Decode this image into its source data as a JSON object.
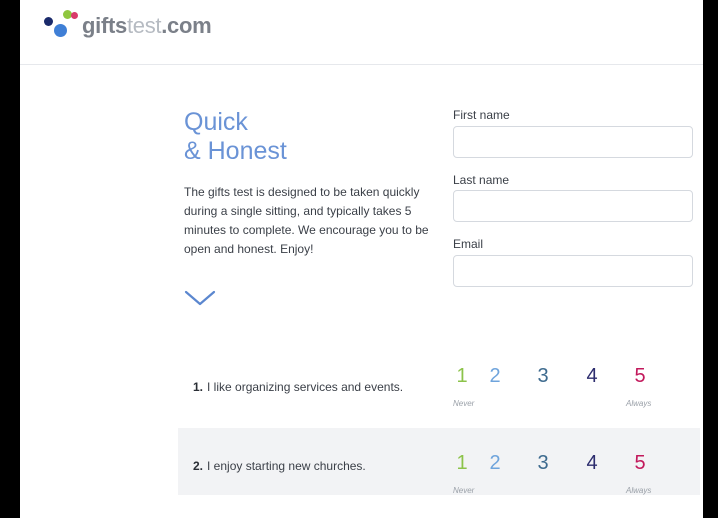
{
  "header": {
    "logo_part1": "gifts",
    "logo_part2": "test",
    "logo_part3": ".com"
  },
  "intro": {
    "title_line1": "Quick",
    "title_line2": "& Honest",
    "body": "The gifts test is designed to be taken quickly during a single sitting, and typically takes 5 minutes to complete. We encourage you to be open and honest. Enjoy!"
  },
  "form": {
    "first_name_label": "First name",
    "last_name_label": "Last name",
    "email_label": "Email"
  },
  "scale": {
    "values": [
      "1",
      "2",
      "3",
      "4",
      "5"
    ],
    "colors": [
      "#8cc34a",
      "#6fa4dc",
      "#3d6a8e",
      "#2d2d6e",
      "#c2185b"
    ],
    "low_hint": "Never",
    "high_hint": "Always"
  },
  "questions": [
    {
      "number": "1.",
      "text": "I like organizing services and events."
    },
    {
      "number": "2.",
      "text": "I enjoy starting new churches."
    }
  ]
}
